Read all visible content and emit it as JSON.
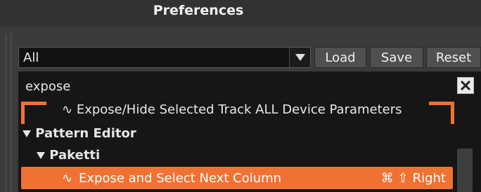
{
  "window": {
    "title": "Preferences"
  },
  "toolbar": {
    "preset_value": "All",
    "load_label": "Load",
    "save_label": "Save",
    "reset_label": "Reset"
  },
  "search": {
    "value": "expose"
  },
  "results": {
    "top_item": {
      "glyph": "∿",
      "label": "Expose/Hide Selected Track ALL Device Parameters"
    },
    "group1": {
      "label": "Pattern Editor"
    },
    "group2": {
      "label": "Paketti"
    },
    "selected_item": {
      "glyph": "∿",
      "label": "Expose and Select Next Column",
      "shortcut_keys": "⌘ ⇧",
      "shortcut_key": "Right"
    }
  },
  "colors": {
    "accent": "#f07233",
    "panel": "#161616",
    "chrome": "#3b3b3b"
  },
  "icons": [
    "combo-arrow-icon",
    "clear-search-icon",
    "disclosure-triangle-icon"
  ]
}
